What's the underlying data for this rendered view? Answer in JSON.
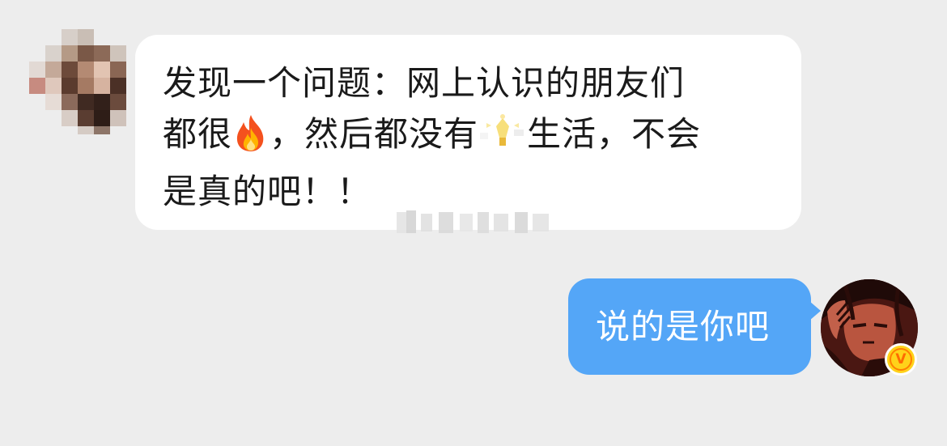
{
  "conversation": {
    "incoming_message": {
      "sender_avatar": "pixelated-avatar",
      "lines": [
        "发现一个问题：网上认识的朋友们",
        {
          "before_emoji": "都很",
          "emoji": "fire-emoji",
          "after_emoji": "，然后都没有",
          "emoji2": "sparkle-lightbulb-sticker",
          "after_emoji2": "生活，不会"
        },
        "是真的吧！！"
      ]
    },
    "outgoing_message": {
      "text": "说的是你吧",
      "sender_avatar": "anime-avatar",
      "verified_badge": "v-badge-icon"
    }
  },
  "colors": {
    "background": "#ededed",
    "incoming_bubble": "#ffffff",
    "outgoing_bubble": "#54a6f7",
    "badge": "#ffd21a"
  }
}
